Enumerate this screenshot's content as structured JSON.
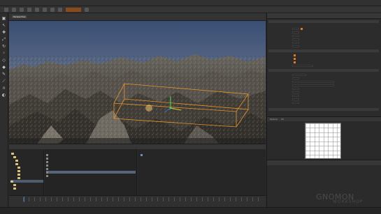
{
  "viewport": {
    "tabs": [
      "Perspective"
    ],
    "bbox_color": "#e8952a"
  },
  "inspector": {
    "tabs": [
      "Texture",
      "UV"
    ]
  },
  "watermark": {
    "brand": "GNOMON",
    "sub": "WORKSHOP"
  },
  "colors": {
    "accent": "#e07a1f",
    "selection": "#55657a",
    "folder": "#d9c27a"
  }
}
